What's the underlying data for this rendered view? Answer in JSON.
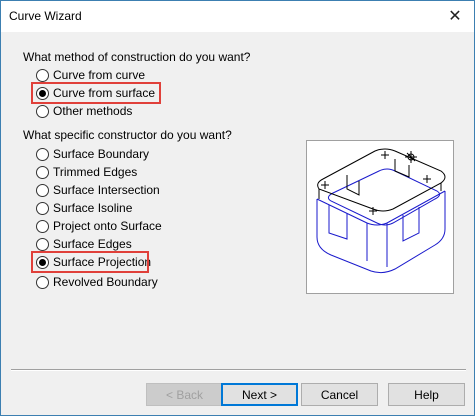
{
  "window": {
    "title": "Curve Wizard",
    "close_glyph": "✕"
  },
  "method": {
    "question": "What method of construction do you want?",
    "options": [
      {
        "label": "Curve from curve",
        "checked": false
      },
      {
        "label": "Curve from surface",
        "checked": true
      },
      {
        "label": "Other methods",
        "checked": false
      }
    ]
  },
  "constructor": {
    "question": "What specific constructor do you want?",
    "options": [
      {
        "label": "Surface Boundary",
        "checked": false
      },
      {
        "label": "Trimmed Edges",
        "checked": false
      },
      {
        "label": "Surface Intersection",
        "checked": false
      },
      {
        "label": "Surface Isoline",
        "checked": false
      },
      {
        "label": "Project onto Surface",
        "checked": false
      },
      {
        "label": "Surface Edges",
        "checked": false
      },
      {
        "label": "Surface Projection",
        "checked": true
      },
      {
        "label": "Revolved Boundary",
        "checked": false
      }
    ]
  },
  "buttons": {
    "back": "< Back",
    "next": "Next >",
    "cancel": "Cancel",
    "help": "Help"
  },
  "colors": {
    "highlight": "#e0403a",
    "preview_blue": "#1a1acc",
    "default_button_border": "#0078d7"
  },
  "icons": {
    "close": "close-icon",
    "preview": "surface-projection-preview-icon"
  }
}
